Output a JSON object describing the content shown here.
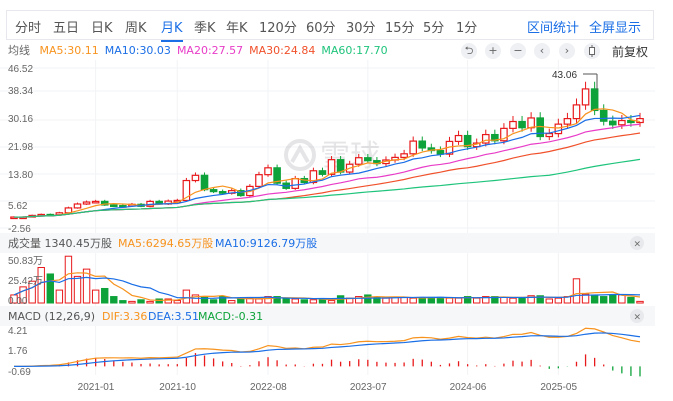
{
  "tabs": [
    {
      "label": "分时"
    },
    {
      "label": "五日"
    },
    {
      "label": "日K"
    },
    {
      "label": "周K"
    },
    {
      "label": "月K",
      "active": true
    },
    {
      "label": "季K"
    },
    {
      "label": "年K"
    },
    {
      "label": "120分"
    },
    {
      "label": "60分"
    },
    {
      "label": "30分"
    },
    {
      "label": "15分"
    },
    {
      "label": "5分"
    },
    {
      "label": "1分"
    }
  ],
  "links": {
    "range_stats": "区间统计",
    "fullscreen": "全屏显示"
  },
  "ma_row": {
    "label": "均线",
    "items": [
      {
        "text": "MA5:30.11",
        "color": "#f7931e"
      },
      {
        "text": "MA10:30.03",
        "color": "#1a6ee6"
      },
      {
        "text": "MA20:27.57",
        "color": "#e83cc8"
      },
      {
        "text": "MA30:24.84",
        "color": "#f0512b"
      },
      {
        "text": "MA60:17.70",
        "color": "#1fc47c"
      }
    ]
  },
  "controls": {
    "undo": "⮌",
    "zoom_in": "+",
    "zoom_out": "−",
    "prev": "‹",
    "next": "›",
    "adjust": "前复权"
  },
  "price_axis": [
    "46.52",
    "38.34",
    "30.16",
    "21.98",
    "13.80",
    "5.62",
    "-2.56"
  ],
  "price_range": [
    -2.56,
    46.52
  ],
  "max_label": "43.06",
  "watermark": "雪球",
  "volume": {
    "title": "成交量 1340.45万股",
    "ma5": "MA5:6294.65万股",
    "ma10": "MA10:9126.79万股",
    "axis": [
      "50.83万",
      "25.42万",
      "0.00"
    ],
    "max": 50.83
  },
  "macd": {
    "title": "MACD (12,26,9)",
    "dif": "DIF:3.36",
    "dea": "DEA:3.51",
    "macd": "MACD:-0.31",
    "axis": [
      "4.21",
      "1.76",
      "-0.69"
    ],
    "range": [
      -0.69,
      4.21
    ]
  },
  "x_labels": [
    {
      "label": "2021-01",
      "index": 9
    },
    {
      "label": "2021-10",
      "index": 18
    },
    {
      "label": "2022-08",
      "index": 28
    },
    {
      "label": "2023-07",
      "index": 39
    },
    {
      "label": "2024-06",
      "index": 50
    },
    {
      "label": "2025-05",
      "index": 60
    }
  ],
  "colors": {
    "up": "#e8191b",
    "down": "#0ea33a",
    "ma5": "#f7931e",
    "ma10": "#1a6ee6",
    "ma20": "#e83cc8",
    "ma30": "#f0512b",
    "ma60": "#1fc47c",
    "accent": "#1a6ee6"
  },
  "chart_data": {
    "type": "candlestick",
    "period": "monthly",
    "closes": [
      0.8,
      0.8,
      1.3,
      1.6,
      1.5,
      2.1,
      3.6,
      4.8,
      5.4,
      5.6,
      4.5,
      4.3,
      4.2,
      4.7,
      4.1,
      5.6,
      4.8,
      5.7,
      5.9,
      12.0,
      13.6,
      9.2,
      8.6,
      8.1,
      8.9,
      7.4,
      10.2,
      13.8,
      15.9,
      11.2,
      9.6,
      12.6,
      11.4,
      15.0,
      13.9,
      18.4,
      14.6,
      17.0,
      19.0,
      18.1,
      17.2,
      18.3,
      19.1,
      20.2,
      24.1,
      22.0,
      21.2,
      20.1,
      24.0,
      25.8,
      22.4,
      23.5,
      26.1,
      24.2,
      28.0,
      30.1,
      28.2,
      31.2,
      25.5,
      26.4,
      29.3,
      31.0,
      35.2,
      40.1,
      33.5,
      30.2,
      29.1,
      30.4,
      29.8,
      31.0
    ],
    "volumes": [
      10,
      20,
      27,
      44,
      36,
      16,
      58,
      33,
      42,
      16,
      18,
      8,
      3,
      2,
      4,
      2,
      5,
      5,
      3,
      16,
      10,
      8,
      4,
      8,
      3,
      5,
      6,
      5,
      8,
      8,
      6,
      5,
      4,
      4,
      5,
      3,
      9,
      6,
      8,
      10,
      7,
      6,
      7,
      7,
      6,
      6,
      7,
      7,
      6,
      6,
      8,
      6,
      8,
      8,
      7,
      6,
      6,
      9,
      9,
      5,
      6,
      8,
      30,
      11,
      9,
      8,
      10,
      10,
      7,
      2
    ]
  }
}
